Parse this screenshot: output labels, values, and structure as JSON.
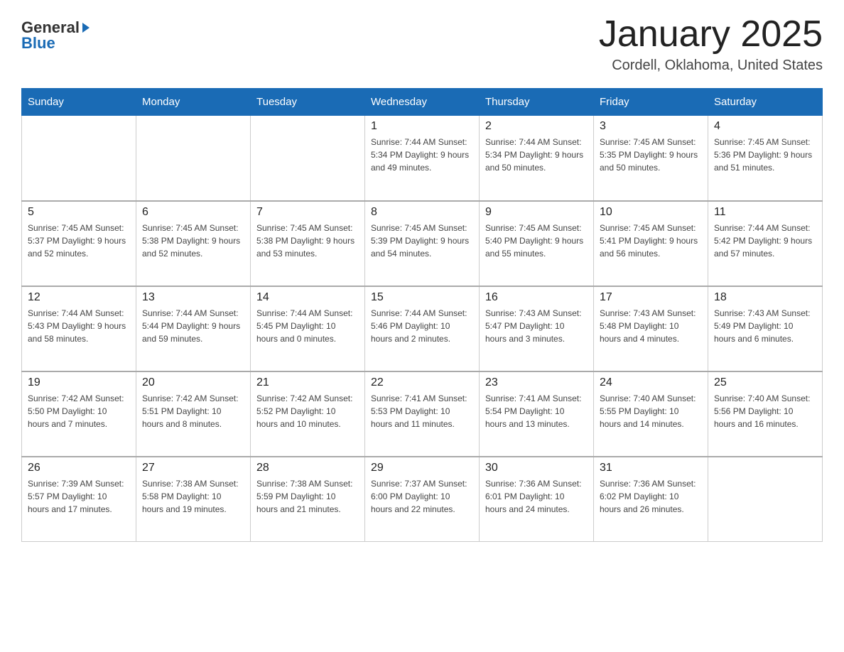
{
  "header": {
    "logo_general": "General",
    "logo_blue": "Blue",
    "title": "January 2025",
    "subtitle": "Cordell, Oklahoma, United States"
  },
  "days_of_week": [
    "Sunday",
    "Monday",
    "Tuesday",
    "Wednesday",
    "Thursday",
    "Friday",
    "Saturday"
  ],
  "weeks": [
    [
      {
        "day": "",
        "info": ""
      },
      {
        "day": "",
        "info": ""
      },
      {
        "day": "",
        "info": ""
      },
      {
        "day": "1",
        "info": "Sunrise: 7:44 AM\nSunset: 5:34 PM\nDaylight: 9 hours\nand 49 minutes."
      },
      {
        "day": "2",
        "info": "Sunrise: 7:44 AM\nSunset: 5:34 PM\nDaylight: 9 hours\nand 50 minutes."
      },
      {
        "day": "3",
        "info": "Sunrise: 7:45 AM\nSunset: 5:35 PM\nDaylight: 9 hours\nand 50 minutes."
      },
      {
        "day": "4",
        "info": "Sunrise: 7:45 AM\nSunset: 5:36 PM\nDaylight: 9 hours\nand 51 minutes."
      }
    ],
    [
      {
        "day": "5",
        "info": "Sunrise: 7:45 AM\nSunset: 5:37 PM\nDaylight: 9 hours\nand 52 minutes."
      },
      {
        "day": "6",
        "info": "Sunrise: 7:45 AM\nSunset: 5:38 PM\nDaylight: 9 hours\nand 52 minutes."
      },
      {
        "day": "7",
        "info": "Sunrise: 7:45 AM\nSunset: 5:38 PM\nDaylight: 9 hours\nand 53 minutes."
      },
      {
        "day": "8",
        "info": "Sunrise: 7:45 AM\nSunset: 5:39 PM\nDaylight: 9 hours\nand 54 minutes."
      },
      {
        "day": "9",
        "info": "Sunrise: 7:45 AM\nSunset: 5:40 PM\nDaylight: 9 hours\nand 55 minutes."
      },
      {
        "day": "10",
        "info": "Sunrise: 7:45 AM\nSunset: 5:41 PM\nDaylight: 9 hours\nand 56 minutes."
      },
      {
        "day": "11",
        "info": "Sunrise: 7:44 AM\nSunset: 5:42 PM\nDaylight: 9 hours\nand 57 minutes."
      }
    ],
    [
      {
        "day": "12",
        "info": "Sunrise: 7:44 AM\nSunset: 5:43 PM\nDaylight: 9 hours\nand 58 minutes."
      },
      {
        "day": "13",
        "info": "Sunrise: 7:44 AM\nSunset: 5:44 PM\nDaylight: 9 hours\nand 59 minutes."
      },
      {
        "day": "14",
        "info": "Sunrise: 7:44 AM\nSunset: 5:45 PM\nDaylight: 10 hours\nand 0 minutes."
      },
      {
        "day": "15",
        "info": "Sunrise: 7:44 AM\nSunset: 5:46 PM\nDaylight: 10 hours\nand 2 minutes."
      },
      {
        "day": "16",
        "info": "Sunrise: 7:43 AM\nSunset: 5:47 PM\nDaylight: 10 hours\nand 3 minutes."
      },
      {
        "day": "17",
        "info": "Sunrise: 7:43 AM\nSunset: 5:48 PM\nDaylight: 10 hours\nand 4 minutes."
      },
      {
        "day": "18",
        "info": "Sunrise: 7:43 AM\nSunset: 5:49 PM\nDaylight: 10 hours\nand 6 minutes."
      }
    ],
    [
      {
        "day": "19",
        "info": "Sunrise: 7:42 AM\nSunset: 5:50 PM\nDaylight: 10 hours\nand 7 minutes."
      },
      {
        "day": "20",
        "info": "Sunrise: 7:42 AM\nSunset: 5:51 PM\nDaylight: 10 hours\nand 8 minutes."
      },
      {
        "day": "21",
        "info": "Sunrise: 7:42 AM\nSunset: 5:52 PM\nDaylight: 10 hours\nand 10 minutes."
      },
      {
        "day": "22",
        "info": "Sunrise: 7:41 AM\nSunset: 5:53 PM\nDaylight: 10 hours\nand 11 minutes."
      },
      {
        "day": "23",
        "info": "Sunrise: 7:41 AM\nSunset: 5:54 PM\nDaylight: 10 hours\nand 13 minutes."
      },
      {
        "day": "24",
        "info": "Sunrise: 7:40 AM\nSunset: 5:55 PM\nDaylight: 10 hours\nand 14 minutes."
      },
      {
        "day": "25",
        "info": "Sunrise: 7:40 AM\nSunset: 5:56 PM\nDaylight: 10 hours\nand 16 minutes."
      }
    ],
    [
      {
        "day": "26",
        "info": "Sunrise: 7:39 AM\nSunset: 5:57 PM\nDaylight: 10 hours\nand 17 minutes."
      },
      {
        "day": "27",
        "info": "Sunrise: 7:38 AM\nSunset: 5:58 PM\nDaylight: 10 hours\nand 19 minutes."
      },
      {
        "day": "28",
        "info": "Sunrise: 7:38 AM\nSunset: 5:59 PM\nDaylight: 10 hours\nand 21 minutes."
      },
      {
        "day": "29",
        "info": "Sunrise: 7:37 AM\nSunset: 6:00 PM\nDaylight: 10 hours\nand 22 minutes."
      },
      {
        "day": "30",
        "info": "Sunrise: 7:36 AM\nSunset: 6:01 PM\nDaylight: 10 hours\nand 24 minutes."
      },
      {
        "day": "31",
        "info": "Sunrise: 7:36 AM\nSunset: 6:02 PM\nDaylight: 10 hours\nand 26 minutes."
      },
      {
        "day": "",
        "info": ""
      }
    ]
  ]
}
